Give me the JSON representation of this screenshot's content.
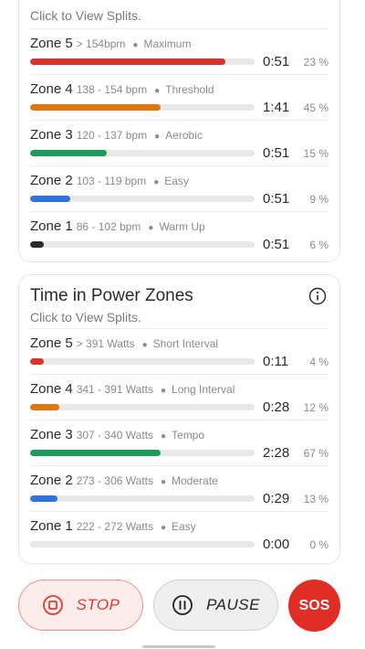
{
  "heart_rate_card": {
    "subtitle": "Click to View Splits.",
    "zones": [
      {
        "name": "Zone 5",
        "range": "> 154bpm",
        "desc": "Maximum",
        "time": "0:51",
        "pct": "23 %",
        "fill": 0.87,
        "color": "#d9342b"
      },
      {
        "name": "Zone 4",
        "range": "138 - 154 bpm",
        "desc": "Threshold",
        "time": "1:41",
        "pct": "45 %",
        "fill": 0.58,
        "color": "#e0760f"
      },
      {
        "name": "Zone 3",
        "range": "120 - 137 bpm",
        "desc": "Aerobic",
        "time": "0:51",
        "pct": "15 %",
        "fill": 0.34,
        "color": "#1e9a5b"
      },
      {
        "name": "Zone 2",
        "range": "103 - 119 bpm",
        "desc": "Easy",
        "time": "0:51",
        "pct": "9 %",
        "fill": 0.18,
        "color": "#2f72e0"
      },
      {
        "name": "Zone 1",
        "range": "86 - 102 bpm",
        "desc": "Warm Up",
        "time": "0:51",
        "pct": "6 %",
        "fill": 0.06,
        "color": "#2a2e33"
      }
    ]
  },
  "power_card": {
    "title": "Time in Power Zones",
    "subtitle": "Click to View Splits.",
    "info_icon": "info-circle-icon",
    "zones": [
      {
        "name": "Zone 5",
        "range": "> 391 Watts",
        "desc": "Short Interval",
        "time": "0:11",
        "pct": "4 %",
        "fill": 0.06,
        "color": "#d9342b"
      },
      {
        "name": "Zone 4",
        "range": "341 - 391 Watts",
        "desc": "Long Interval",
        "time": "0:28",
        "pct": "12 %",
        "fill": 0.13,
        "color": "#e0760f"
      },
      {
        "name": "Zone 3",
        "range": "307 - 340 Watts",
        "desc": "Tempo",
        "time": "2:28",
        "pct": "67 %",
        "fill": 0.58,
        "color": "#1e9a5b"
      },
      {
        "name": "Zone 2",
        "range": "273 - 306 Watts",
        "desc": "Moderate",
        "time": "0:29",
        "pct": "13 %",
        "fill": 0.12,
        "color": "#2f72e0"
      },
      {
        "name": "Zone 1",
        "range": "222 - 272 Watts",
        "desc": "Easy",
        "time": "0:00",
        "pct": "0 %",
        "fill": 0.0,
        "color": "#2a2e33"
      }
    ]
  },
  "controls": {
    "stop_label": "STOP",
    "pause_label": "PAUSE",
    "sos_label": "SOS",
    "stop_icon": "stop-circle-icon",
    "pause_icon": "pause-circle-icon",
    "accent": "#e02e26"
  }
}
